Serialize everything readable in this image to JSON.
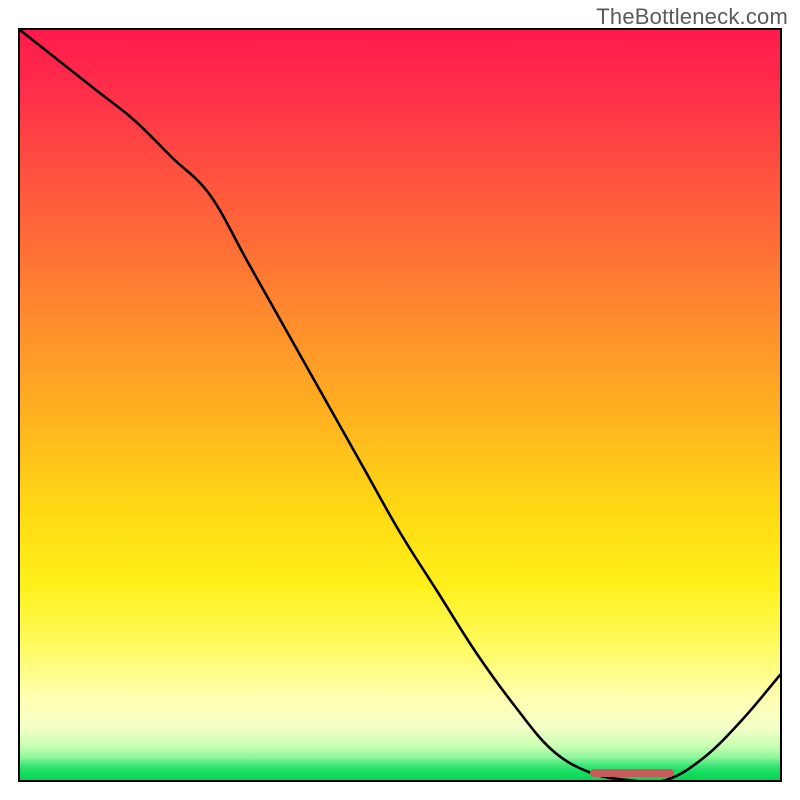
{
  "watermark": "TheBottleneck.com",
  "chart_data": {
    "type": "line",
    "title": "",
    "xlabel": "",
    "ylabel": "",
    "xlim": [
      0,
      100
    ],
    "ylim": [
      0,
      100
    ],
    "grid": false,
    "legend": false,
    "series": [
      {
        "name": "bottleneck-curve",
        "x": [
          0,
          5,
          10,
          15,
          20,
          25,
          30,
          35,
          40,
          45,
          50,
          55,
          60,
          65,
          70,
          75,
          80,
          85,
          90,
          95,
          100
        ],
        "values": [
          100,
          96,
          92,
          88,
          83,
          78,
          69,
          60,
          51,
          42,
          33,
          25,
          17,
          10,
          4,
          1,
          0,
          0,
          3,
          8,
          14
        ]
      }
    ],
    "annotations": [
      {
        "name": "optimal-range-marker",
        "x_start": 75,
        "x_end": 86,
        "y": 1
      }
    ],
    "background_gradient": {
      "orientation": "vertical",
      "stops": [
        {
          "pos": 0.0,
          "color": "#ff1a4d"
        },
        {
          "pos": 0.5,
          "color": "#ffc61a"
        },
        {
          "pos": 0.85,
          "color": "#ffff90"
        },
        {
          "pos": 1.0,
          "color": "#07d556"
        }
      ]
    }
  },
  "plot": {
    "inner_w": 760,
    "inner_h": 750
  }
}
